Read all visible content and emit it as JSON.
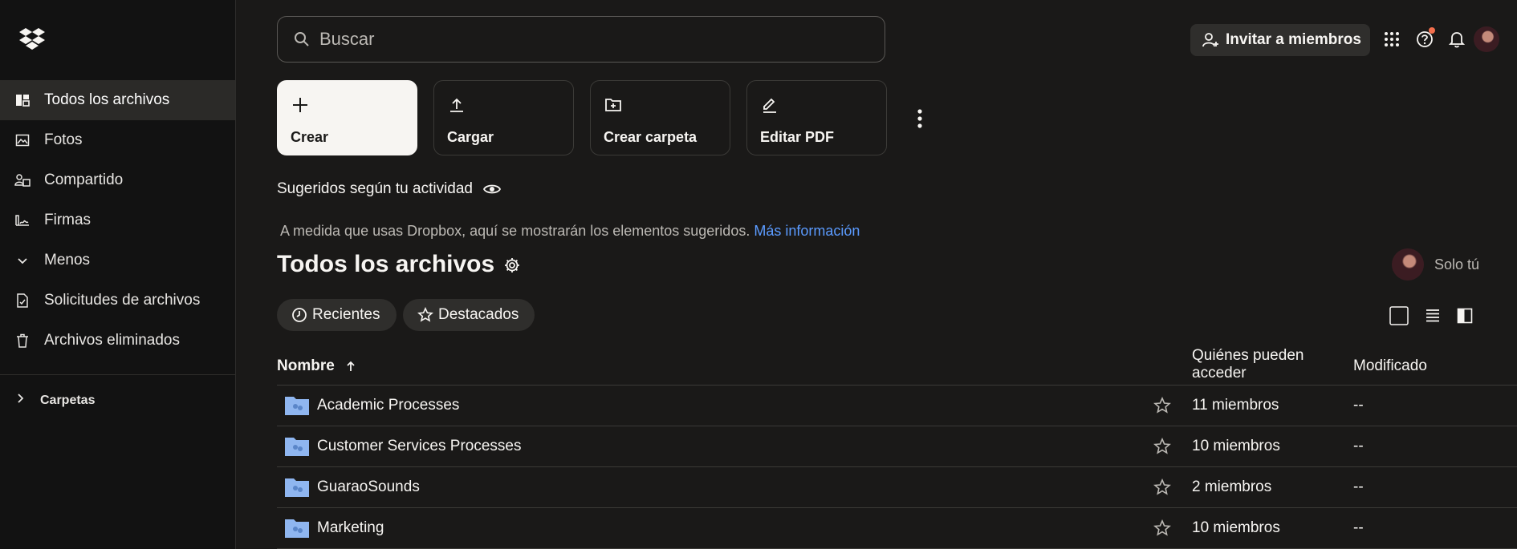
{
  "app": {
    "logo_icon": "dropbox-logo"
  },
  "sidebar": {
    "items": [
      {
        "label": "Todos los archivos",
        "icon": "files-icon",
        "active": true
      },
      {
        "label": "Fotos",
        "icon": "photo-icon"
      },
      {
        "label": "Compartido",
        "icon": "shared-icon"
      },
      {
        "label": "Firmas",
        "icon": "signature-icon"
      },
      {
        "label": "Menos",
        "icon": "chevron-down-icon"
      },
      {
        "label": "Solicitudes de archivos",
        "icon": "file-request-icon"
      },
      {
        "label": "Archivos eliminados",
        "icon": "trash-icon"
      }
    ],
    "folders_label": "Carpetas"
  },
  "search": {
    "placeholder": "Buscar"
  },
  "header": {
    "invite_label": "Invitar a miembros"
  },
  "actions": [
    {
      "label": "Crear",
      "icon": "plus-icon"
    },
    {
      "label": "Cargar",
      "icon": "upload-icon"
    },
    {
      "label": "Crear carpeta",
      "icon": "folder-plus-icon"
    },
    {
      "label": "Editar PDF",
      "icon": "pencil-icon"
    }
  ],
  "suggested": {
    "title": "Sugeridos según tu actividad",
    "description": "A medida que usas Dropbox, aquí se mostrarán los elementos sugeridos.",
    "link": "Más información"
  },
  "main": {
    "title": "Todos los archivos",
    "owner_label": "Solo tú",
    "chips": [
      "Recientes",
      "Destacados"
    ]
  },
  "table": {
    "columns": {
      "name": "Nombre",
      "access": "Quiénes pueden acceder",
      "modified": "Modificado"
    },
    "rows": [
      {
        "name": "Academic Processes",
        "access": "11 miembros",
        "modified": "--"
      },
      {
        "name": "Customer Services Processes",
        "access": "10 miembros",
        "modified": "--"
      },
      {
        "name": "GuaraoSounds",
        "access": "2 miembros",
        "modified": "--"
      },
      {
        "name": "Marketing",
        "access": "10 miembros",
        "modified": "--"
      }
    ]
  },
  "colors": {
    "background": "#1a1918",
    "sidebar": "#121212",
    "link": "#5b9bff",
    "folder": "#8fb6f0",
    "notification": "#f46f4d"
  }
}
